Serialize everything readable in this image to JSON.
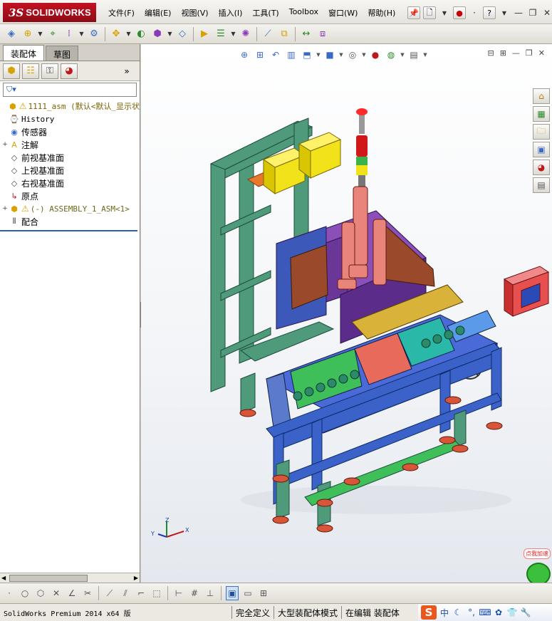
{
  "app": {
    "brand_prefix": "3S",
    "brand_name": "SOLIDWORKS"
  },
  "menu": [
    {
      "label": "文件(F)",
      "name": "menu-file"
    },
    {
      "label": "编辑(E)",
      "name": "menu-edit"
    },
    {
      "label": "视图(V)",
      "name": "menu-view"
    },
    {
      "label": "插入(I)",
      "name": "menu-insert"
    },
    {
      "label": "工具(T)",
      "name": "menu-tools"
    },
    {
      "label": "Toolbox",
      "name": "menu-toolbox"
    },
    {
      "label": "窗口(W)",
      "name": "menu-window"
    },
    {
      "label": "帮助(H)",
      "name": "menu-help"
    }
  ],
  "title_icons": {
    "pin": "pin-icon",
    "new": "new-document-icon",
    "rebuild": "traffic-light-icon",
    "help": "help-icon"
  },
  "toolbar_icons": [
    "new-component-icon",
    "insert-component-icon",
    "mate-icon",
    "linear-pattern-icon",
    "smart-fasteners-icon",
    "move-component-icon",
    "show-hidden-icon",
    "assembly-features-icon",
    "reference-geometry-icon",
    "new-motion-study-icon",
    "bill-of-materials-icon",
    "exploded-view-icon",
    "explode-line-icon",
    "interference-icon",
    "clearance-icon",
    "instant3d-icon"
  ],
  "panel": {
    "tabs": [
      {
        "label": "装配体",
        "name": "tab-assembly"
      },
      {
        "label": "草图",
        "name": "tab-sketch"
      }
    ],
    "manager_icons": [
      "feature-manager-icon",
      "property-manager-icon",
      "configuration-manager-icon",
      "display-manager-icon"
    ],
    "more_glyph": "»",
    "tree": [
      {
        "name": "tree-root-assembly",
        "expander": "",
        "icon": "assembly-icon",
        "warn": true,
        "text": "1111_asm  (默认<默认_显示状",
        "style": "gold mono"
      },
      {
        "name": "tree-history",
        "expander": "",
        "icon": "history-icon",
        "warn": false,
        "text": "History",
        "style": "mono"
      },
      {
        "name": "tree-sensors",
        "expander": "",
        "icon": "sensor-icon",
        "warn": false,
        "text": "传感器",
        "style": "cn"
      },
      {
        "name": "tree-annotations",
        "expander": "+",
        "icon": "annotation-icon",
        "warn": false,
        "text": "注解",
        "style": "cn"
      },
      {
        "name": "tree-front-plane",
        "expander": "",
        "icon": "plane-icon",
        "warn": false,
        "text": "前视基准面",
        "style": "cn"
      },
      {
        "name": "tree-top-plane",
        "expander": "",
        "icon": "plane-icon",
        "warn": false,
        "text": "上视基准面",
        "style": "cn"
      },
      {
        "name": "tree-right-plane",
        "expander": "",
        "icon": "plane-icon",
        "warn": false,
        "text": "右视基准面",
        "style": "cn"
      },
      {
        "name": "tree-origin",
        "expander": "",
        "icon": "origin-icon",
        "warn": false,
        "text": "原点",
        "style": "cn"
      },
      {
        "name": "tree-subassembly",
        "expander": "+",
        "icon": "assembly-icon",
        "warn": true,
        "text": "(-) ASSEMBLY_1_ASM<1>",
        "style": "olive mono"
      },
      {
        "name": "tree-mates",
        "expander": "",
        "icon": "mates-icon",
        "warn": false,
        "text": "配合",
        "style": "cn"
      }
    ]
  },
  "heads_up_icons": [
    "zoom-to-fit-icon",
    "zoom-to-area-icon",
    "previous-view-icon",
    "section-view-icon",
    "view-orientation-icon",
    "display-style-icon",
    "hide-show-items-icon",
    "edit-appearance-icon",
    "apply-scene-icon",
    "view-settings-icon"
  ],
  "task_pane_icons": [
    "solidworks-resources-icon",
    "design-library-icon",
    "file-explorer-icon",
    "view-palette-icon",
    "appearances-icon",
    "custom-properties-icon"
  ],
  "triad": {
    "x": "X",
    "y": "Y",
    "z": "Z"
  },
  "speed_badge": "点我加速",
  "sketch_toolbar_icons": [
    "point-icon",
    "circle-icon",
    "polygon-icon",
    "cross-icon",
    "angle-icon",
    "trim-icon",
    "extend-icon",
    "offset-icon",
    "corner-icon",
    "rectangle-icon",
    "dimension-icon",
    "grid-icon",
    "relation-icon",
    "cube-icon",
    "single-view-icon",
    "split-view-icon"
  ],
  "status": {
    "version": "SolidWorks Premium 2014 x64 版",
    "cells": [
      "完全定义",
      "大型装配体模式",
      "在编辑 装配体"
    ]
  },
  "ime": {
    "logo": "S",
    "mode": "中",
    "icons": [
      "moon-icon",
      "punctuation-icon",
      "keyboard-icon",
      "skin-icon",
      "shirt-icon",
      "wrench-icon"
    ]
  },
  "colors": {
    "frame_teal": "#4e9a7a",
    "brand_red": "#c41222",
    "accent_yellow": "#f2e21a"
  }
}
